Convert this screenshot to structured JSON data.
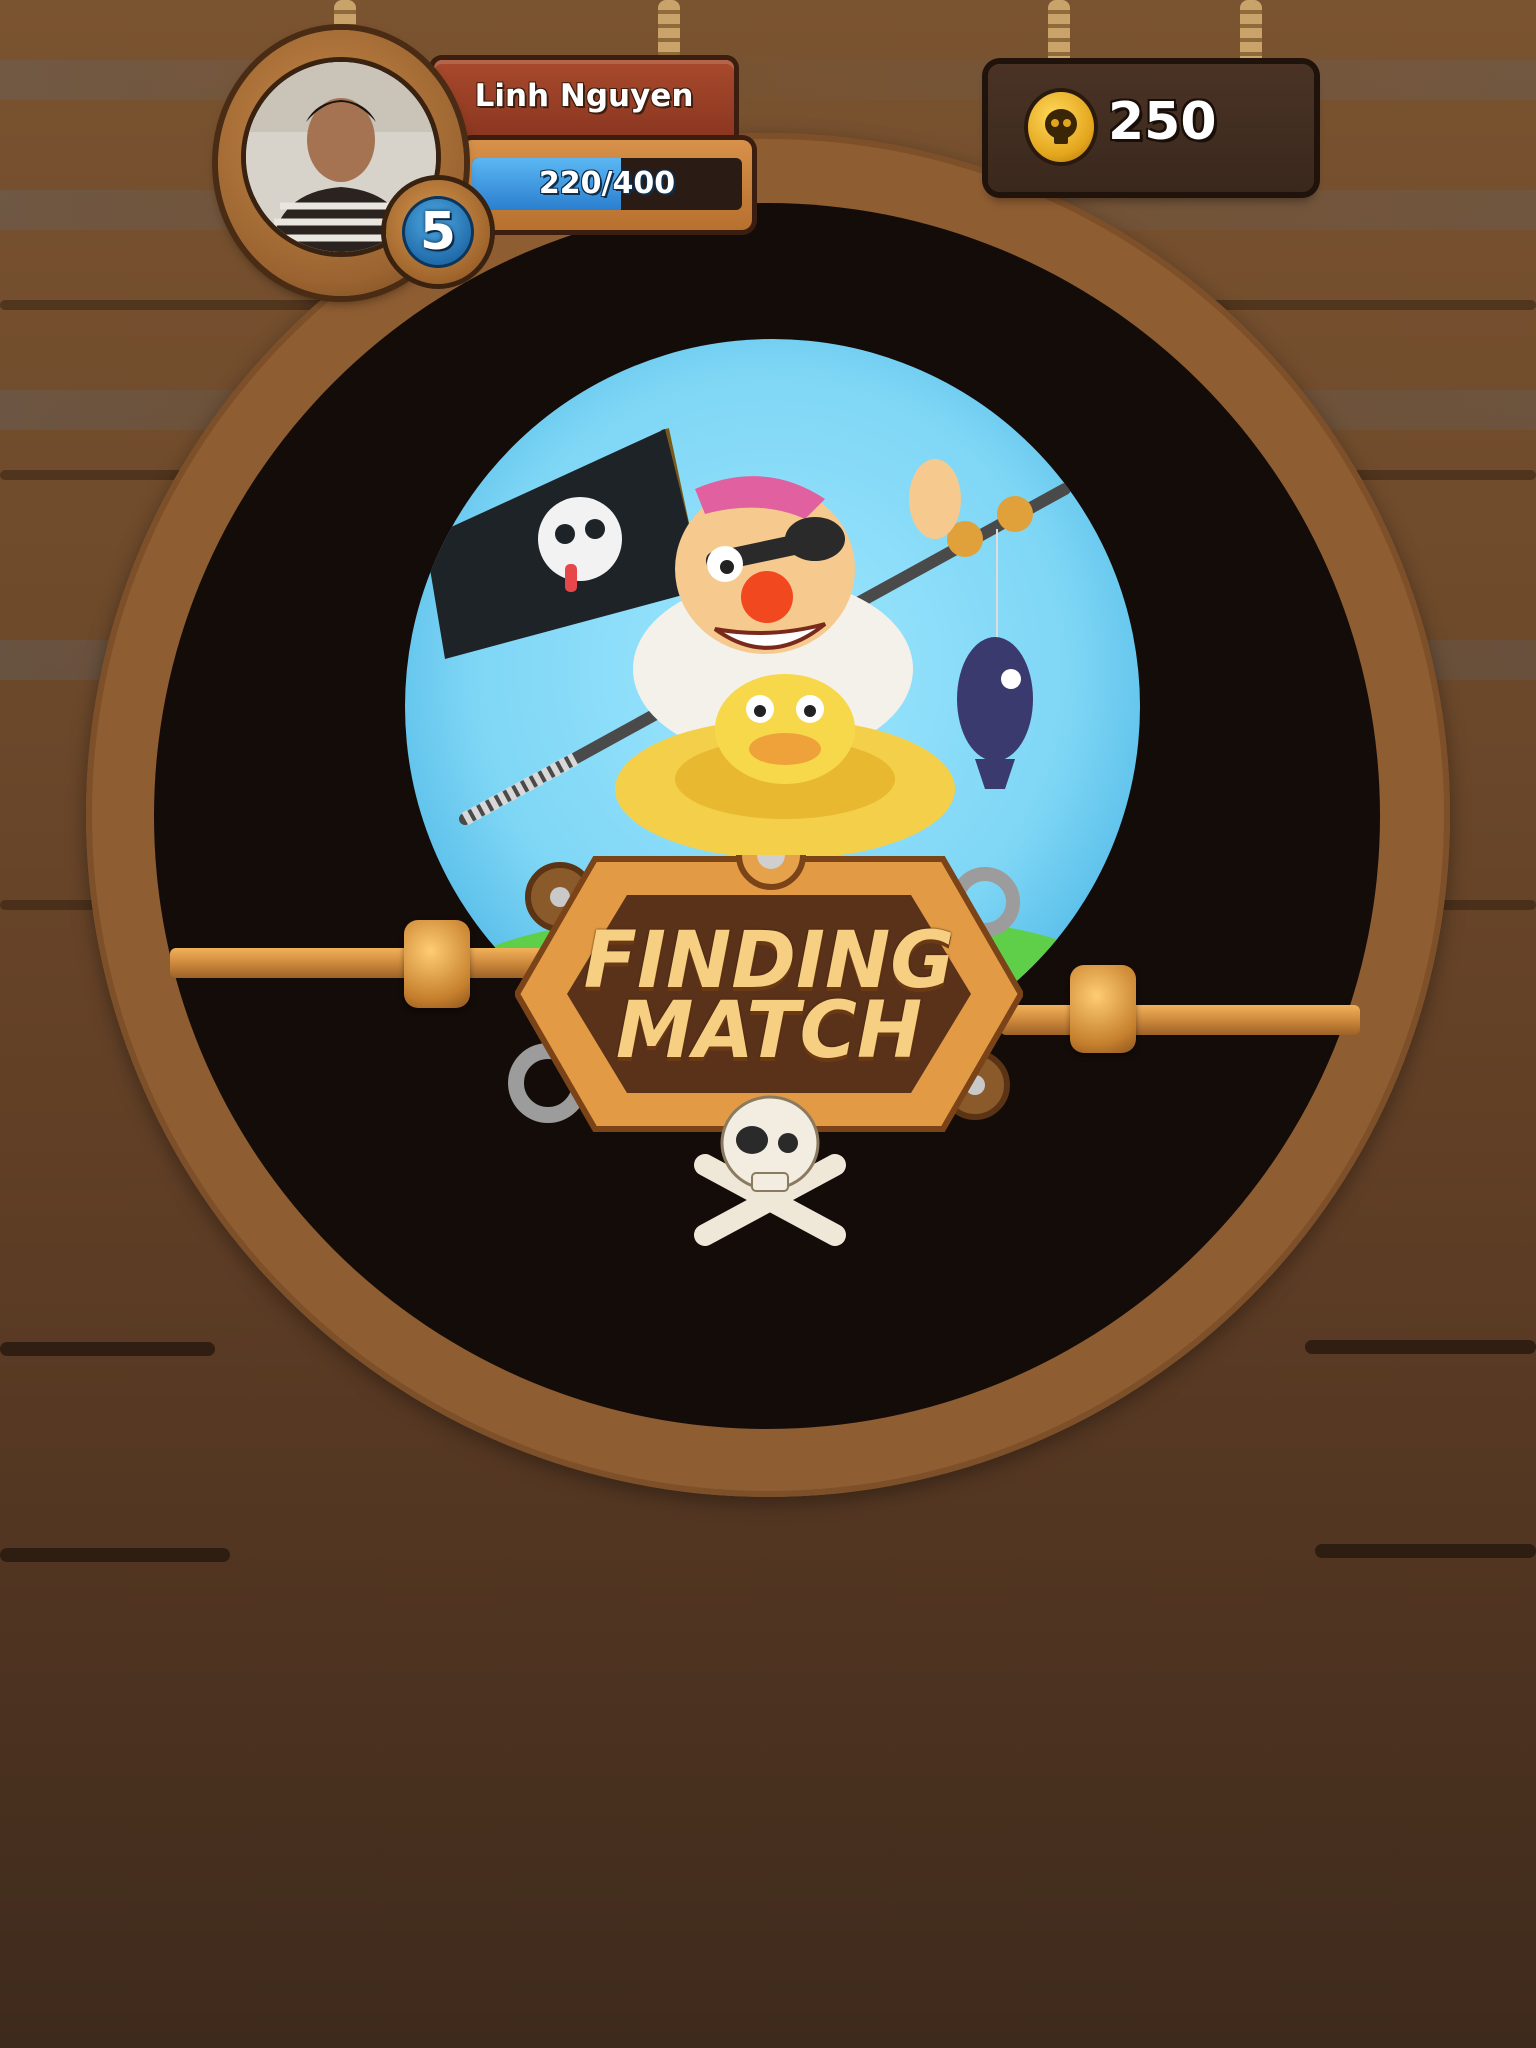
{
  "player": {
    "name": "Linh Nguyen",
    "level": "5",
    "xp_text": "220/400",
    "xp_fraction": 0.55
  },
  "currency": {
    "coins": "250",
    "icon": "skull-coin-icon"
  },
  "status": {
    "line1": "FINDING",
    "line2": "MATCH"
  },
  "colors": {
    "wood": "#7a5330",
    "porthole_ring": "#8f5d32",
    "sky": "#7ed6f5",
    "sign_text": "#f6cf83",
    "xp_bar": "#2b7fcf",
    "coin": "#e3a51c"
  }
}
